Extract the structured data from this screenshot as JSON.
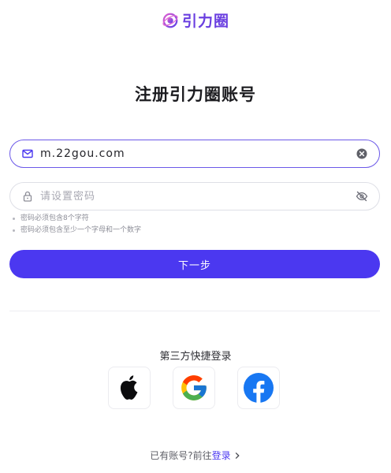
{
  "brand": {
    "name": "引力圈",
    "accent_color": "#4b38f0",
    "logo_icon": "orbit-logo-icon"
  },
  "page": {
    "title": "注册引力圈账号"
  },
  "email_field": {
    "value": "m.22gou.com",
    "lead_icon": "mail-icon",
    "trail_icon": "clear-icon"
  },
  "password_field": {
    "value": "",
    "placeholder": "请设置密码",
    "lead_icon": "lock-icon",
    "trail_icon": "eye-off-icon"
  },
  "password_hints": [
    "密码必须包含8个字符",
    "密码必须包含至少一个字母和一个数字"
  ],
  "next_button": {
    "label": "下一步"
  },
  "third_party": {
    "title": "第三方快捷登录",
    "providers": [
      {
        "icon": "apple-icon"
      },
      {
        "icon": "google-icon"
      },
      {
        "icon": "facebook-icon"
      }
    ]
  },
  "footer": {
    "prompt": "已有账号?前往",
    "login_label": "登录",
    "chevron_icon": "chevron-right-icon"
  }
}
